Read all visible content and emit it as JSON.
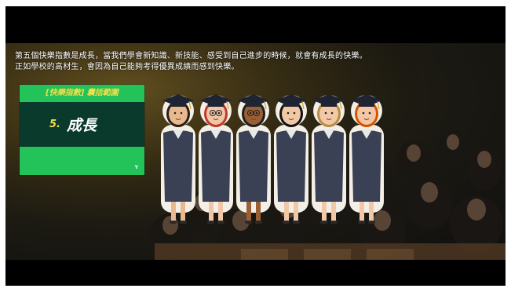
{
  "caption": {
    "line1": "第五個快樂指數是成長，當我們學會新知識、新技能、感受到自己進步的時候，就會有成長的快樂。",
    "line2": "正如學校的高材生，會因為自己能夠考得優異成績而感到快樂。"
  },
  "card": {
    "header": "[快樂指數] 囊括範圍",
    "number": "5.",
    "title": "成長",
    "tag": "Y"
  },
  "colors": {
    "card_green": "#24c35a",
    "card_dark": "#0a3a2c",
    "accent_yellow": "#f4df4a",
    "gown": "#3b4155"
  },
  "graduates": [
    {
      "hair": "#2b1d14",
      "skin": "#e8b98f",
      "glasses": false
    },
    {
      "hair": "#c0392b",
      "skin": "#f1c6a6",
      "glasses": true
    },
    {
      "hair": "#1e1e1e",
      "skin": "#9a5f34",
      "glasses": true
    },
    {
      "hair": "#111111",
      "skin": "#f0c8a5",
      "glasses": false
    },
    {
      "hair": "#b98b45",
      "skin": "#f2c9a6",
      "glasses": false
    },
    {
      "hair": "#d35400",
      "skin": "#f3c7a5",
      "glasses": false
    }
  ]
}
